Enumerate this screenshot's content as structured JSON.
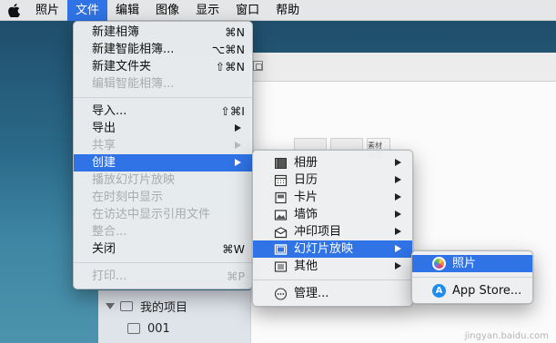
{
  "menubar": {
    "items": [
      "照片",
      "文件",
      "编辑",
      "图像",
      "显示",
      "窗口",
      "帮助"
    ],
    "active_index": 1
  },
  "file_menu": {
    "items": [
      {
        "label": "新建相簿",
        "shortcut": "⌘N",
        "disabled": false
      },
      {
        "label": "新建智能相簿...",
        "shortcut": "⌥⌘N",
        "disabled": false
      },
      {
        "label": "新建文件夹",
        "shortcut": "⇧⌘N",
        "disabled": false
      },
      {
        "label": "编辑智能相簿...",
        "shortcut": "",
        "disabled": true
      },
      {
        "label": "导入...",
        "shortcut": "⇧⌘I",
        "disabled": false
      },
      {
        "label": "导出",
        "submenu": true,
        "disabled": false
      },
      {
        "label": "共享",
        "submenu": true,
        "disabled": true
      },
      {
        "label": "创建",
        "submenu": true,
        "disabled": false,
        "active": true
      },
      {
        "label": "播放幻灯片放映",
        "disabled": true
      },
      {
        "label": "在时刻中显示",
        "disabled": true
      },
      {
        "label": "在访达中显示引用文件",
        "disabled": true
      },
      {
        "label": "整合...",
        "disabled": true
      },
      {
        "label": "关闭",
        "shortcut": "⌘W",
        "disabled": false
      },
      {
        "label": "打印...",
        "shortcut": "⌘P",
        "disabled": true
      }
    ]
  },
  "create_menu": {
    "items": [
      {
        "label": "相册",
        "icon": "book-icon"
      },
      {
        "label": "日历",
        "icon": "calendar-icon"
      },
      {
        "label": "卡片",
        "icon": "card-icon"
      },
      {
        "label": "墙饰",
        "icon": "wall-decor-icon"
      },
      {
        "label": "冲印项目",
        "icon": "prints-icon"
      },
      {
        "label": "幻灯片放映",
        "icon": "slideshow-icon",
        "active": true
      },
      {
        "label": "其他",
        "icon": "other-icon"
      },
      {
        "label": "管理...",
        "icon": "ellipsis-icon"
      }
    ]
  },
  "slideshow_menu": {
    "items": [
      {
        "label": "照片",
        "icon": "photos-app-icon"
      },
      {
        "label": "App Store...",
        "icon": "app-store-icon"
      }
    ]
  },
  "sidebar": {
    "my_projects_label": "我的项目",
    "project_item_label": "001"
  },
  "thumbnail_text": "素材\n标题",
  "watermark": "jingyan.baidu.com",
  "colors": {
    "selection": "#2f73e6",
    "menu_bg": "#eceef0",
    "desktop": "#2b6a8a"
  }
}
